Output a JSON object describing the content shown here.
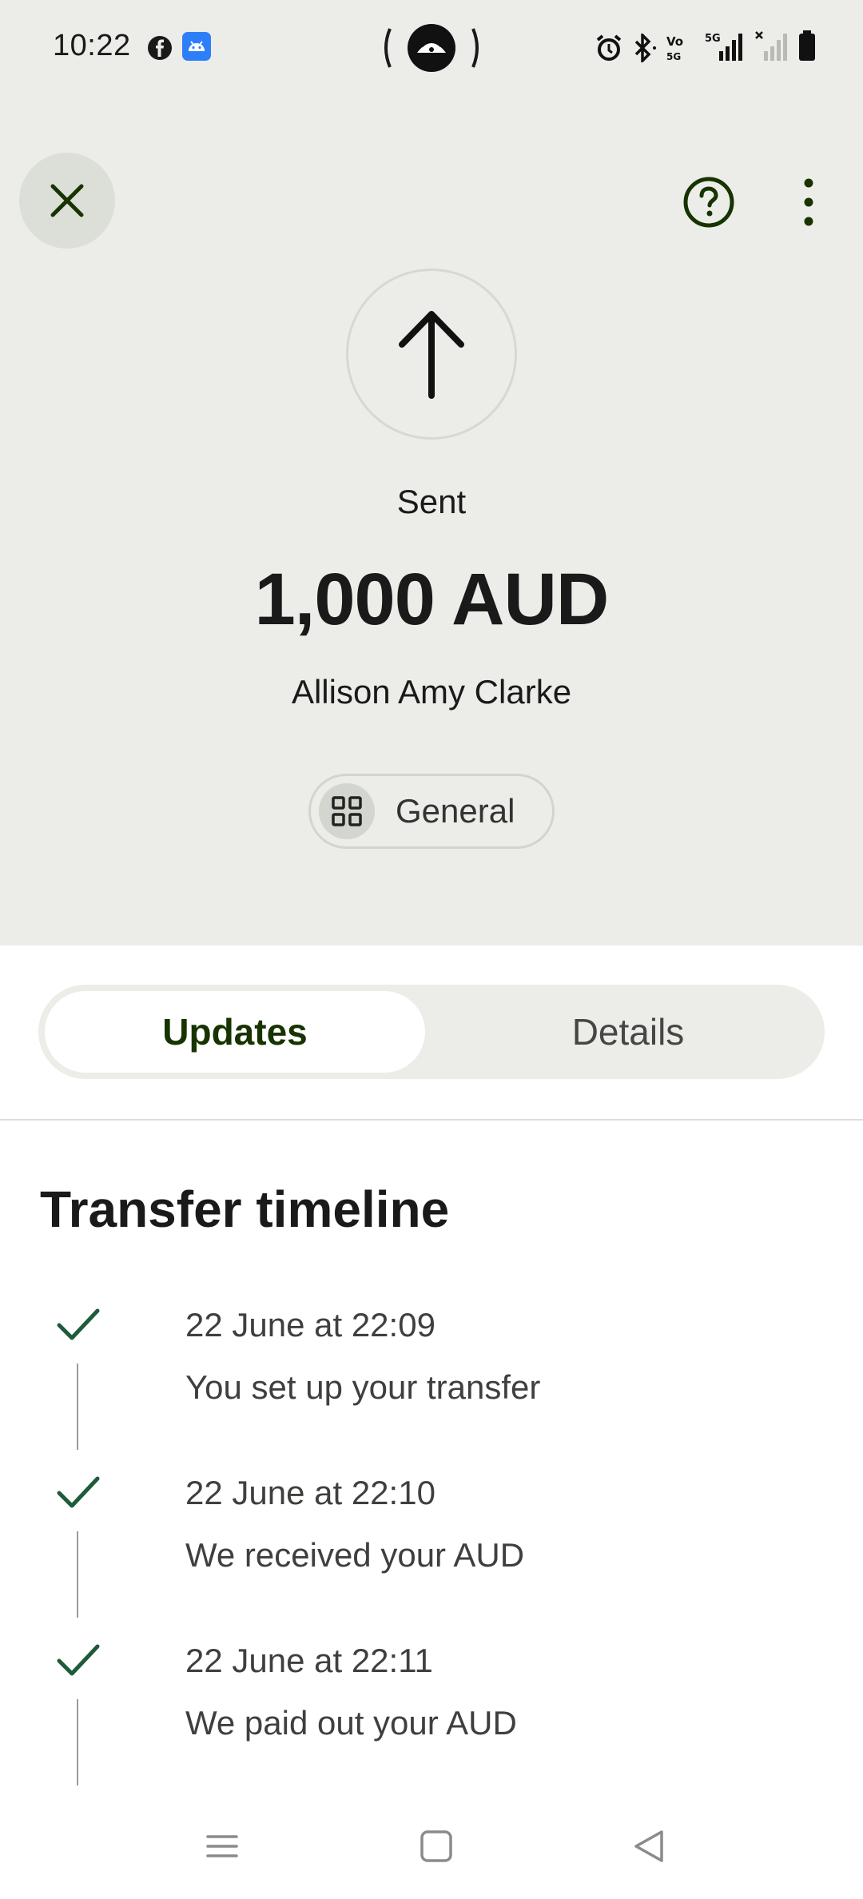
{
  "status_bar": {
    "time": "10:22",
    "icons": [
      "facebook-icon",
      "android-icon",
      "hotspot-icon",
      "alarm-icon",
      "bluetooth-icon",
      "volte-icon",
      "signal-5g-icon",
      "signal-no-sim-icon",
      "battery-icon"
    ]
  },
  "header": {
    "close_icon": "close-icon",
    "help_icon": "help-icon",
    "more_icon": "more-vertical-icon"
  },
  "transaction": {
    "direction_icon": "arrow-up-icon",
    "status": "Sent",
    "amount": "1,000 AUD",
    "recipient": "Allison Amy Clarke",
    "category": {
      "icon": "grid-icon",
      "label": "General"
    }
  },
  "tabs": [
    {
      "label": "Updates",
      "active": true
    },
    {
      "label": "Details",
      "active": false
    }
  ],
  "timeline": {
    "title": "Transfer timeline",
    "items": [
      {
        "date": "22 June at 22:09",
        "text": "You set up your transfer",
        "icon": "check-icon"
      },
      {
        "date": "22 June at 22:10",
        "text": "We received your AUD",
        "icon": "check-icon"
      },
      {
        "date": "22 June at 22:11",
        "text": "We paid out your AUD",
        "icon": "check-icon"
      }
    ]
  },
  "nav_bar": {
    "buttons": [
      "recents-icon",
      "home-icon",
      "back-icon"
    ]
  },
  "colors": {
    "top_background": "#ecede8",
    "accent_dark_green": "#163300",
    "check_green": "#1e5b3a"
  }
}
